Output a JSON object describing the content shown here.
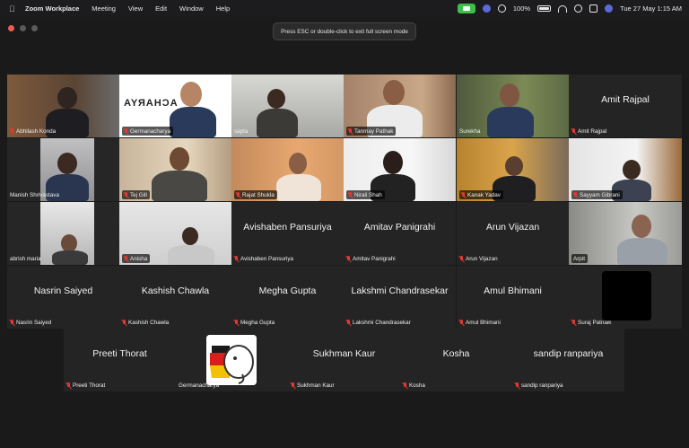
{
  "menubar": {
    "app_name": "Zoom Workplace",
    "menus": [
      "Meeting",
      "View",
      "Edit",
      "Window",
      "Help"
    ],
    "battery": "100%",
    "datetime": "Tue 27 May  1:15 AM"
  },
  "tooltip": "Press ESC or double-click to exit full screen mode",
  "grid": {
    "row1": [
      {
        "name": "Abhilash Konda"
      },
      {
        "name": "Germanacharya",
        "logo_text": "ACHARYA"
      },
      {
        "name": "sapta"
      },
      {
        "name": "Tanmay Pathak"
      },
      {
        "name": "Surekha"
      },
      {
        "name": "Amit Rajpal",
        "big": "Amit Rajpal"
      }
    ],
    "row2": [
      {
        "name": "Manish Shrivastava"
      },
      {
        "name": "Tej Gill"
      },
      {
        "name": "Rajat Shukla"
      },
      {
        "name": "Nirali Shah"
      },
      {
        "name": "Kanak Yadav"
      },
      {
        "name": "Sayyam Gibrani"
      }
    ],
    "row3": [
      {
        "name": "abrish maria"
      },
      {
        "name": "Anisha"
      },
      {
        "name": "Avishaben Pansuriya",
        "big": "Avishaben Pansuriya"
      },
      {
        "name": "Amitav Panigrahi",
        "big": "Amitav Panigrahi"
      },
      {
        "name": "Arun Vijazan",
        "big": "Arun Vijazan"
      },
      {
        "name": "Arpit"
      }
    ],
    "row4": [
      {
        "name": "Nasrin Saiyed",
        "big": "Nasrin Saiyed"
      },
      {
        "name": "Kashish Chawla",
        "big": "Kashish Chawla"
      },
      {
        "name": "Megha Gupta",
        "big": "Megha Gupta"
      },
      {
        "name": "Lakshmi Chandrasekar",
        "big": "Lakshmi Chandrasekar"
      },
      {
        "name": "Amul Bhimani",
        "big": "Amul Bhimani"
      },
      {
        "name": "Suraj Patnaik"
      }
    ],
    "row5": [
      {
        "name": "Preeti Thorat",
        "big": "Preeti Thorat"
      },
      {
        "name": "Germanacharya"
      },
      {
        "name": "Sukhman Kaur",
        "big": "Sukhman Kaur"
      },
      {
        "name": "Kosha",
        "big": "Kosha"
      },
      {
        "name": "sandip ranpariya",
        "big": "sandip ranpariya"
      }
    ]
  },
  "colors": {
    "active_speaker": "#3fbf4a",
    "muted": "#e53935",
    "tile_bg": "#242424"
  }
}
